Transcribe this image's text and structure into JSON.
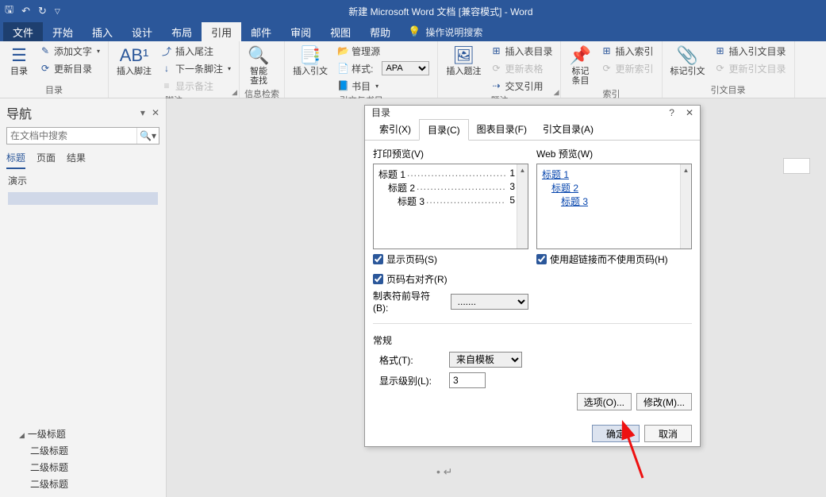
{
  "title": "新建 Microsoft Word 文档 [兼容模式]  -  Word",
  "menu": {
    "file": "文件",
    "home": "开始",
    "insert": "插入",
    "design": "设计",
    "layout": "布局",
    "references": "引用",
    "mail": "邮件",
    "review": "审阅",
    "view": "视图",
    "help": "帮助",
    "tellme": "操作说明搜索"
  },
  "ribbon": {
    "toc": {
      "btn": "目录",
      "addtext": "添加文字",
      "update": "更新目录",
      "group": "目录"
    },
    "footnote": {
      "insert": "插入脚注",
      "endnote": "插入尾注",
      "next": "下一条脚注",
      "show": "显示备注",
      "group": "脚注"
    },
    "smartlookup": {
      "btn": "智能\n查找",
      "group": "信息检索"
    },
    "citation": {
      "insert": "插入引文",
      "manage": "管理源",
      "style": "样式:",
      "style_val": "APA",
      "bib": "书目",
      "group": "引文与书目"
    },
    "caption": {
      "insert": "插入题注",
      "tof": "插入表目录",
      "updatetbl": "更新表格",
      "crossref": "交叉引用",
      "group": "题注"
    },
    "index": {
      "mark": "标记\n条目",
      "insert": "插入索引",
      "update": "更新索引",
      "group": "索引"
    },
    "toa": {
      "mark": "标记引文",
      "insert": "插入引文目录",
      "update": "更新引文目录",
      "group": "引文目录"
    }
  },
  "nav": {
    "title": "导航",
    "search_placeholder": "在文档中搜索",
    "tabs": {
      "headings": "标题",
      "pages": "页面",
      "results": "结果"
    },
    "info": "演示",
    "outline": {
      "l1": "一级标题",
      "l2a": "二级标题",
      "l2b": "二级标题",
      "l2c": "二级标题"
    }
  },
  "dialog": {
    "title": "目录",
    "help": "?",
    "close": "✕",
    "tabs": {
      "index": "索引(X)",
      "toc": "目录(C)",
      "tof": "图表目录(F)",
      "toa": "引文目录(A)"
    },
    "print_preview": "打印预览(V)",
    "web_preview": "Web 预览(W)",
    "toc_items": [
      {
        "label": "标题  1",
        "page": "1"
      },
      {
        "label": "标题  2",
        "page": "3"
      },
      {
        "label": "标题  3",
        "page": "5"
      }
    ],
    "web_items": [
      "标题  1",
      "标题  2",
      "标题  3"
    ],
    "show_page_num": "显示页码(S)",
    "right_align": "页码右对齐(R)",
    "leader_label": "制表符前导符(B):",
    "leader_val": ".......",
    "use_hyperlinks": "使用超链接而不使用页码(H)",
    "general": "常规",
    "format_label": "格式(T):",
    "format_val": "来自模板",
    "levels_label": "显示级别(L):",
    "levels_val": "3",
    "options": "选项(O)...",
    "modify": "修改(M)...",
    "ok": "确定",
    "cancel": "取消"
  }
}
